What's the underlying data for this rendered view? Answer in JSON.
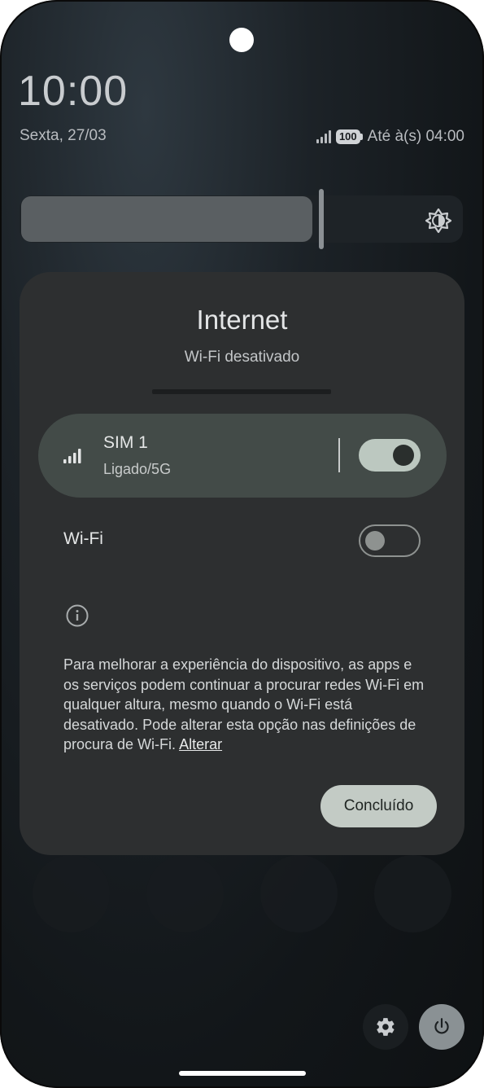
{
  "status": {
    "time": "10:00",
    "date": "Sexta, 27/03",
    "battery": "100",
    "alarm": "Até à(s) 04:00"
  },
  "dialog": {
    "title": "Internet",
    "subtitle": "Wi-Fi desativado",
    "sim": {
      "name": "SIM 1",
      "status": "Ligado/5G",
      "enabled": true
    },
    "wifi": {
      "label": "Wi-Fi",
      "enabled": false
    },
    "info_text": "Para melhorar a experiência do dispositivo, as apps e os serviços podem continuar a procurar redes Wi-Fi em qualquer altura, mesmo quando o Wi-Fi está desativado. Pode alterar esta opção nas definições de procura de Wi-Fi.",
    "info_link": "Alterar",
    "done_label": "Concluído"
  },
  "colors": {
    "dialog_bg": "#2d2f30",
    "sim_card_bg": "#434b48",
    "toggle_on": "#bcc8c0",
    "done_button": "#c3cbc5"
  },
  "icons": [
    "signal-icon",
    "battery-icon",
    "brightness-icon",
    "cell-signal-icon",
    "info-icon",
    "settings-icon",
    "power-icon"
  ]
}
